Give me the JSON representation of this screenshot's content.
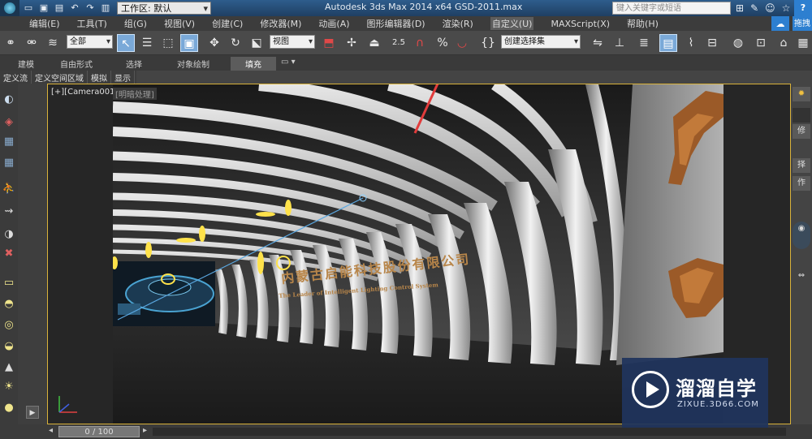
{
  "titlebar": {
    "workspace_label": "工作区: 默认",
    "app_title": "Autodesk 3ds Max  2014 x64",
    "file_name": "GSD-2011.max",
    "search_placeholder": "键入关键字或短语"
  },
  "menu": {
    "items": [
      "编辑(E)",
      "工具(T)",
      "组(G)",
      "视图(V)",
      "创建(C)",
      "修改器(M)",
      "动画(A)",
      "图形编辑器(D)",
      "渲染(R)",
      "自定义(U)",
      "MAXScript(X)",
      "帮助(H)"
    ],
    "sync_label": "拖拽"
  },
  "toolbar": {
    "filter_select": "全部",
    "ref_coord_select": "视图",
    "named_selection_select": "创建选择集",
    "snap_value": "2.5"
  },
  "ribbon": {
    "tabs": [
      "建模",
      "自由形式",
      "选择",
      "对象绘制",
      "填充"
    ]
  },
  "subtoolbar": {
    "items": [
      "定义流",
      "定义空间区域",
      "模拟",
      "显示"
    ]
  },
  "viewport": {
    "label": "[+][Camera001]",
    "sublabel": "[明暗处理]",
    "signage_cn": "内蒙古启能科技股份有限公司",
    "signage_en": "The Leader of Intelligent Lighting Control System"
  },
  "rightpanel": {
    "tabs": [
      "修",
      "择",
      "作"
    ]
  },
  "timeline": {
    "frame_label": "0 / 100"
  },
  "watermark": {
    "brand": "溜溜自学",
    "url": "ZIXUE.3D66.COM"
  },
  "colors": {
    "viewport_border": "#d9b23a",
    "active_button": "#7aa9d8",
    "titlebar": "#2e5d8c",
    "arrow": "#e23c3c",
    "signage": "#b8864a"
  }
}
